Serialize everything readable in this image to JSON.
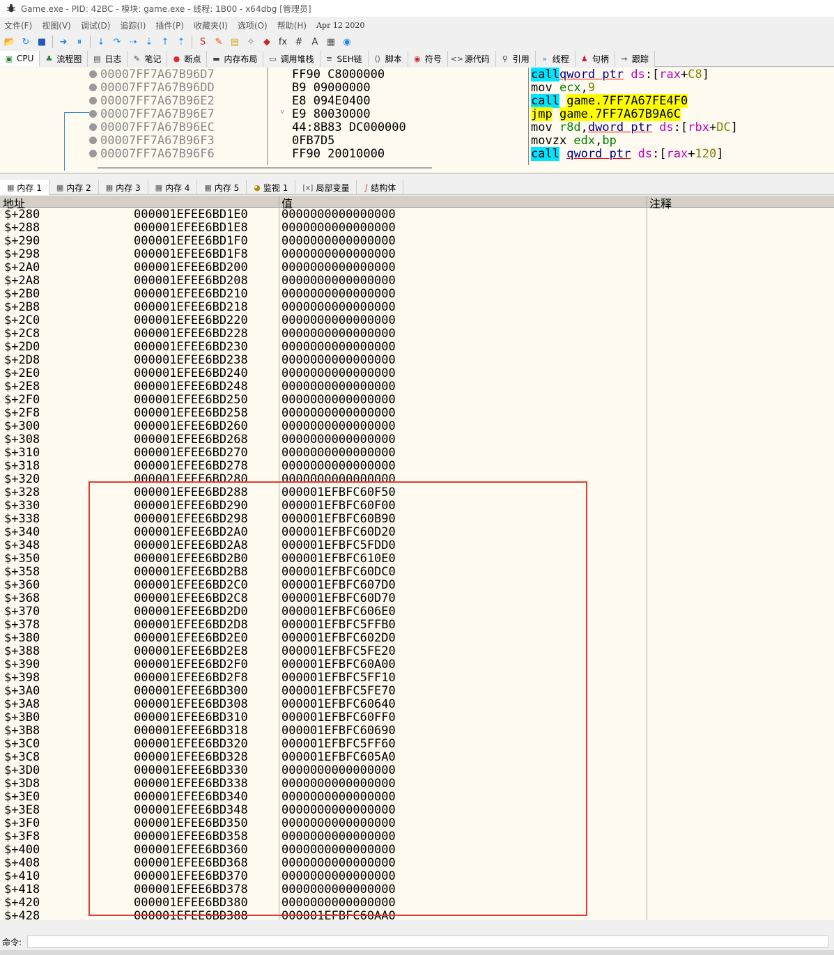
{
  "window": {
    "title": "Game.exe - PID: 42BC - 模块: game.exe - 线程: 1B00 - x64dbg [管理员]"
  },
  "menu": {
    "items": [
      "文件(F)",
      "视图(V)",
      "调试(D)",
      "追踪(I)",
      "插件(P)",
      "收藏夹(I)",
      "选项(O)",
      "帮助(H)"
    ],
    "date": "Apr 12 2020"
  },
  "toolbar": {
    "icons": [
      "open-icon",
      "restart-icon",
      "stop-icon",
      "run-icon",
      "pause-icon",
      "step-into-icon",
      "step-over-icon",
      "trace-into-icon",
      "trace-over-icon",
      "execute-till-return-icon",
      "run-to-user-code-icon",
      "script-icon",
      "patch-icon",
      "comment-icon",
      "label-icon",
      "bookmark-icon",
      "function-icon",
      "hash-icon",
      "font-icon",
      "calculator-icon",
      "globe-icon"
    ]
  },
  "tabs": [
    {
      "label": "CPU",
      "icon": "cpu-icon"
    },
    {
      "label": "流程图",
      "icon": "graph-icon"
    },
    {
      "label": "日志",
      "icon": "log-icon"
    },
    {
      "label": "笔记",
      "icon": "notes-icon"
    },
    {
      "label": "断点",
      "icon": "breakpoint-icon"
    },
    {
      "label": "内存布局",
      "icon": "memory-map-icon"
    },
    {
      "label": "调用堆栈",
      "icon": "call-stack-icon"
    },
    {
      "label": "SEH链",
      "icon": "seh-icon"
    },
    {
      "label": "脚本",
      "icon": "script-icon"
    },
    {
      "label": "符号",
      "icon": "symbols-icon"
    },
    {
      "label": "源代码",
      "icon": "source-icon"
    },
    {
      "label": "引用",
      "icon": "references-icon"
    },
    {
      "label": "线程",
      "icon": "threads-icon"
    },
    {
      "label": "句柄",
      "icon": "handles-icon"
    },
    {
      "label": "跟踪",
      "icon": "trace-icon"
    }
  ],
  "disasm": [
    {
      "addr": "00007FF7A67B96D7",
      "bytes": "FF90 C8000000",
      "jmark": "",
      "instr": [
        [
          "kw-call",
          "call"
        ],
        [
          "",
          "",
          " "
        ],
        [
          "ptr",
          "qword ptr"
        ],
        [
          "",
          " "
        ],
        [
          "seg",
          "ds"
        ],
        [
          "brk",
          ":["
        ],
        [
          "seg",
          "rax"
        ],
        [
          "brk",
          "+"
        ],
        [
          "num",
          "C8"
        ],
        [
          "brk",
          "]"
        ]
      ]
    },
    {
      "addr": "00007FF7A67B96DD",
      "bytes": "B9 09000000",
      "jmark": "",
      "instr": [
        [
          "",
          "mov "
        ],
        [
          "reg",
          "ecx"
        ],
        [
          "brk",
          ","
        ],
        [
          "num",
          "9"
        ]
      ]
    },
    {
      "addr": "00007FF7A67B96E2",
      "bytes": "E8 094E0400",
      "jmark": "",
      "instr": [
        [
          "kw-call",
          "call"
        ],
        [
          "",
          " "
        ],
        [
          "tgt",
          "game.7FF7A67FE4F0"
        ]
      ]
    },
    {
      "addr": "00007FF7A67B96E7",
      "bytes": "E9 80030000",
      "jmark": "˅",
      "instr": [
        [
          "kw-jmp",
          "jmp"
        ],
        [
          "",
          " "
        ],
        [
          "tgt",
          "game.7FF7A67B9A6C"
        ]
      ]
    },
    {
      "addr": "00007FF7A67B96EC",
      "bytes": "44:8B83 DC000000",
      "jmark": "",
      "instr": [
        [
          "",
          "mov "
        ],
        [
          "reg",
          "r8d"
        ],
        [
          "brk",
          ","
        ],
        [
          "ptr",
          "dword ptr"
        ],
        [
          "",
          " "
        ],
        [
          "seg",
          "ds"
        ],
        [
          "brk",
          ":["
        ],
        [
          "seg",
          "rbx"
        ],
        [
          "brk",
          "+"
        ],
        [
          "num",
          "DC"
        ],
        [
          "brk",
          "]"
        ]
      ]
    },
    {
      "addr": "00007FF7A67B96F3",
      "bytes": "0FB7D5",
      "jmark": "",
      "instr": [
        [
          "",
          "movzx "
        ],
        [
          "reg",
          "edx"
        ],
        [
          "brk",
          ","
        ],
        [
          "reg",
          "bp"
        ]
      ]
    },
    {
      "addr": "00007FF7A67B96F6",
      "bytes": "FF90 20010000",
      "jmark": "",
      "instr": [
        [
          "kw-call",
          "call"
        ],
        [
          "",
          " "
        ],
        [
          "ptr",
          "qword ptr"
        ],
        [
          "",
          " "
        ],
        [
          "seg",
          "ds"
        ],
        [
          "brk",
          ":["
        ],
        [
          "seg",
          "rax"
        ],
        [
          "brk",
          "+"
        ],
        [
          "num",
          "120"
        ],
        [
          "brk",
          "]"
        ]
      ]
    }
  ],
  "dumptabs": [
    {
      "label": "内存 1",
      "icon": "dump-icon"
    },
    {
      "label": "内存 2",
      "icon": "dump-icon"
    },
    {
      "label": "内存 3",
      "icon": "dump-icon"
    },
    {
      "label": "内存 4",
      "icon": "dump-icon"
    },
    {
      "label": "内存 5",
      "icon": "dump-icon"
    },
    {
      "label": "监视 1",
      "icon": "watch-icon"
    },
    {
      "label": "局部变量",
      "icon": "locals-icon"
    },
    {
      "label": "结构体",
      "icon": "struct-icon"
    }
  ],
  "dump": {
    "headers": {
      "addr": "地址",
      "value": "值",
      "comment": "注释"
    },
    "rows": [
      [
        "$+280",
        "000001EFEE6BD1E0",
        "0000000000000000"
      ],
      [
        "$+288",
        "000001EFEE6BD1E8",
        "0000000000000000"
      ],
      [
        "$+290",
        "000001EFEE6BD1F0",
        "0000000000000000"
      ],
      [
        "$+298",
        "000001EFEE6BD1F8",
        "0000000000000000"
      ],
      [
        "$+2A0",
        "000001EFEE6BD200",
        "0000000000000000"
      ],
      [
        "$+2A8",
        "000001EFEE6BD208",
        "0000000000000000"
      ],
      [
        "$+2B0",
        "000001EFEE6BD210",
        "0000000000000000"
      ],
      [
        "$+2B8",
        "000001EFEE6BD218",
        "0000000000000000"
      ],
      [
        "$+2C0",
        "000001EFEE6BD220",
        "0000000000000000"
      ],
      [
        "$+2C8",
        "000001EFEE6BD228",
        "0000000000000000"
      ],
      [
        "$+2D0",
        "000001EFEE6BD230",
        "0000000000000000"
      ],
      [
        "$+2D8",
        "000001EFEE6BD238",
        "0000000000000000"
      ],
      [
        "$+2E0",
        "000001EFEE6BD240",
        "0000000000000000"
      ],
      [
        "$+2E8",
        "000001EFEE6BD248",
        "0000000000000000"
      ],
      [
        "$+2F0",
        "000001EFEE6BD250",
        "0000000000000000"
      ],
      [
        "$+2F8",
        "000001EFEE6BD258",
        "0000000000000000"
      ],
      [
        "$+300",
        "000001EFEE6BD260",
        "0000000000000000"
      ],
      [
        "$+308",
        "000001EFEE6BD268",
        "0000000000000000"
      ],
      [
        "$+310",
        "000001EFEE6BD270",
        "0000000000000000"
      ],
      [
        "$+318",
        "000001EFEE6BD278",
        "0000000000000000"
      ],
      [
        "$+320",
        "000001EFEE6BD280",
        "0000000000000000"
      ],
      [
        "$+328",
        "000001EFEE6BD288",
        "000001EFBFC60F50"
      ],
      [
        "$+330",
        "000001EFEE6BD290",
        "000001EFBFC60F00"
      ],
      [
        "$+338",
        "000001EFEE6BD298",
        "000001EFBFC60B90"
      ],
      [
        "$+340",
        "000001EFEE6BD2A0",
        "000001EFBFC60D20"
      ],
      [
        "$+348",
        "000001EFEE6BD2A8",
        "000001EFBFC5FDD0"
      ],
      [
        "$+350",
        "000001EFEE6BD2B0",
        "000001EFBFC610E0"
      ],
      [
        "$+358",
        "000001EFEE6BD2B8",
        "000001EFBFC60DC0"
      ],
      [
        "$+360",
        "000001EFEE6BD2C0",
        "000001EFBFC607D0"
      ],
      [
        "$+368",
        "000001EFEE6BD2C8",
        "000001EFBFC60D70"
      ],
      [
        "$+370",
        "000001EFEE6BD2D0",
        "000001EFBFC606E0"
      ],
      [
        "$+378",
        "000001EFEE6BD2D8",
        "000001EFBFC5FFB0"
      ],
      [
        "$+380",
        "000001EFEE6BD2E0",
        "000001EFBFC602D0"
      ],
      [
        "$+388",
        "000001EFEE6BD2E8",
        "000001EFBFC5FE20"
      ],
      [
        "$+390",
        "000001EFEE6BD2F0",
        "000001EFBFC60A00"
      ],
      [
        "$+398",
        "000001EFEE6BD2F8",
        "000001EFBFC5FF10"
      ],
      [
        "$+3A0",
        "000001EFEE6BD300",
        "000001EFBFC5FE70"
      ],
      [
        "$+3A8",
        "000001EFEE6BD308",
        "000001EFBFC60640"
      ],
      [
        "$+3B0",
        "000001EFEE6BD310",
        "000001EFBFC60FF0"
      ],
      [
        "$+3B8",
        "000001EFEE6BD318",
        "000001EFBFC60690"
      ],
      [
        "$+3C0",
        "000001EFEE6BD320",
        "000001EFBFC5FF60"
      ],
      [
        "$+3C8",
        "000001EFEE6BD328",
        "000001EFBFC605A0"
      ],
      [
        "$+3D0",
        "000001EFEE6BD330",
        "0000000000000000"
      ],
      [
        "$+3D8",
        "000001EFEE6BD338",
        "0000000000000000"
      ],
      [
        "$+3E0",
        "000001EFEE6BD340",
        "0000000000000000"
      ],
      [
        "$+3E8",
        "000001EFEE6BD348",
        "0000000000000000"
      ],
      [
        "$+3F0",
        "000001EFEE6BD350",
        "0000000000000000"
      ],
      [
        "$+3F8",
        "000001EFEE6BD358",
        "0000000000000000"
      ],
      [
        "$+400",
        "000001EFEE6BD360",
        "0000000000000000"
      ],
      [
        "$+408",
        "000001EFEE6BD368",
        "0000000000000000"
      ],
      [
        "$+410",
        "000001EFEE6BD370",
        "0000000000000000"
      ],
      [
        "$+418",
        "000001EFEE6BD378",
        "0000000000000000"
      ],
      [
        "$+420",
        "000001EFEE6BD380",
        "0000000000000000"
      ],
      [
        "$+428",
        "000001EFEE6BD388",
        "000001EFBFC60AA0"
      ]
    ]
  },
  "cmdbar": {
    "label": "命令:"
  },
  "colors": {
    "highlight_box": "#e53935",
    "call_bg": "#00e5ff",
    "jmp_bg": "#ffff00",
    "pane_bg": "#fffbf0"
  }
}
